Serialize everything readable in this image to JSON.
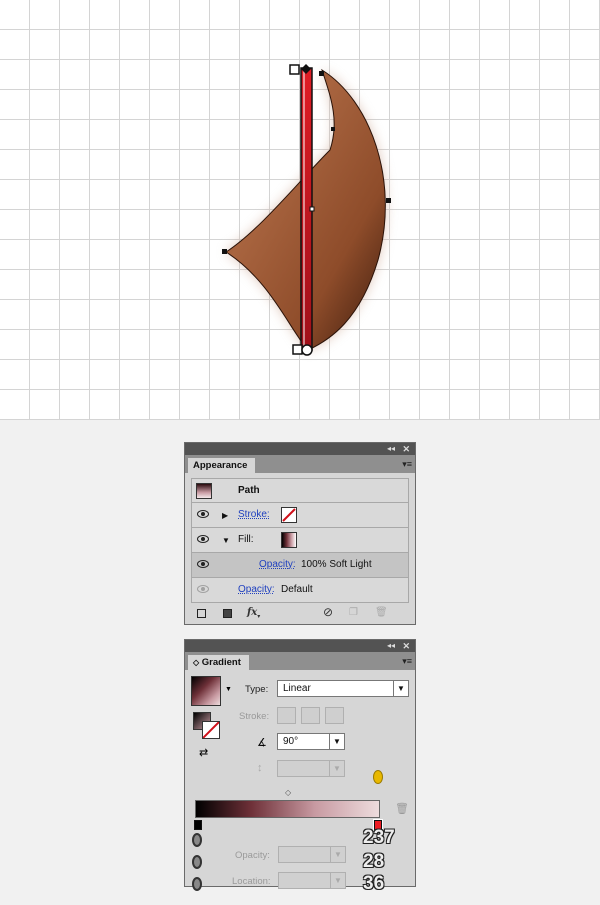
{
  "appearance": {
    "title": "Appearance",
    "object": "Path",
    "stroke_label": "Stroke:",
    "fill_label": "Fill:",
    "fill_opacity_label": "Opacity:",
    "fill_opacity_value": "100% Soft Light",
    "opacity_label": "Opacity:",
    "opacity_value": "Default"
  },
  "gradient": {
    "title": "Gradient",
    "type_label": "Type:",
    "type_value": "Linear",
    "stroke_label": "Stroke:",
    "angle_value": "90°",
    "opacity_label": "Opacity:",
    "location_label": "Location:",
    "ramp_colors": [
      "#000000",
      "#6e3038",
      "#c89aa2",
      "#eddcdd"
    ],
    "color_values": [
      "237",
      "28",
      "36"
    ]
  },
  "canvas": {
    "shape_colors": {
      "light": "#a5623f",
      "dark": "#4a2412",
      "bar": "#c8161d"
    }
  }
}
